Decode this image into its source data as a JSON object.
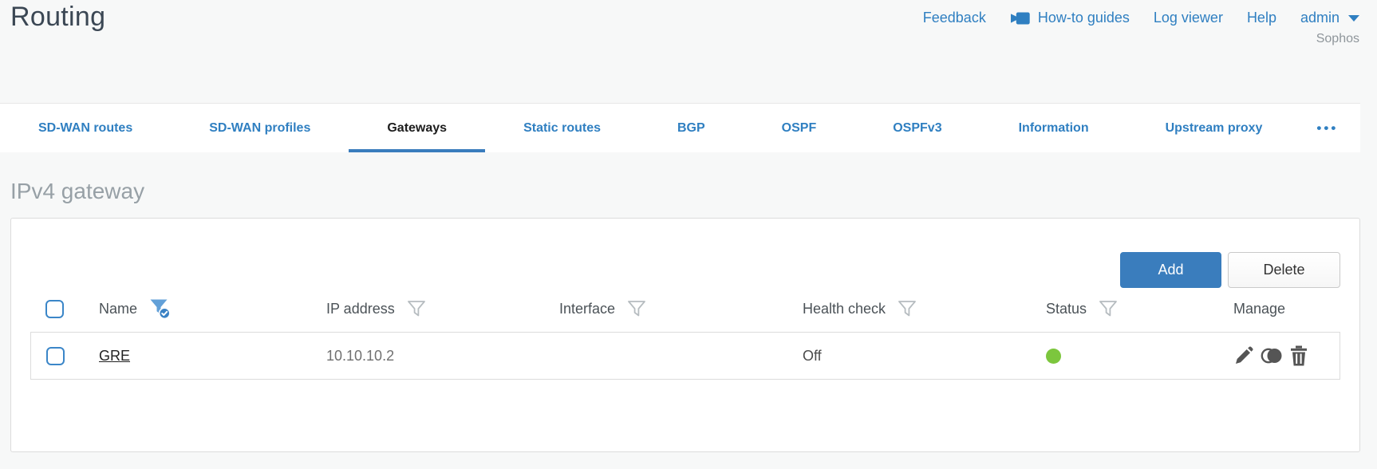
{
  "title": "Routing",
  "header": {
    "feedback": "Feedback",
    "howto_guides": "How-to guides",
    "log_viewer": "Log viewer",
    "help": "Help",
    "user": "admin",
    "brand": "Sophos"
  },
  "tabs": {
    "items": [
      {
        "label": "SD-WAN routes",
        "active": false
      },
      {
        "label": "SD-WAN profiles",
        "active": false
      },
      {
        "label": "Gateways",
        "active": true
      },
      {
        "label": "Static routes",
        "active": false
      },
      {
        "label": "BGP",
        "active": false
      },
      {
        "label": "OSPF",
        "active": false
      },
      {
        "label": "OSPFv3",
        "active": false
      },
      {
        "label": "Information",
        "active": false
      },
      {
        "label": "Upstream proxy",
        "active": false
      }
    ],
    "more": "•••"
  },
  "section": {
    "heading": "IPv4 gateway"
  },
  "toolbar": {
    "add_label": "Add",
    "delete_label": "Delete"
  },
  "table": {
    "columns": [
      {
        "label": "Name",
        "filter": "active"
      },
      {
        "label": "IP address",
        "filter": "inactive"
      },
      {
        "label": "Interface",
        "filter": "inactive"
      },
      {
        "label": "Health check",
        "filter": "inactive"
      },
      {
        "label": "Status",
        "filter": "inactive"
      },
      {
        "label": "Manage",
        "filter": "none"
      }
    ],
    "rows": [
      {
        "name": "GRE",
        "ip_address": "10.10.10.2",
        "interface": "",
        "health_check": "Off",
        "status": "up",
        "status_color": "#7cc63d",
        "actions": [
          "edit",
          "clone",
          "delete"
        ]
      }
    ]
  },
  "colors": {
    "accent_blue": "#2f7fc1",
    "button_blue": "#3a7dbd",
    "status_green": "#7cc63d",
    "active_tab_underline": "#3a7dbd"
  }
}
